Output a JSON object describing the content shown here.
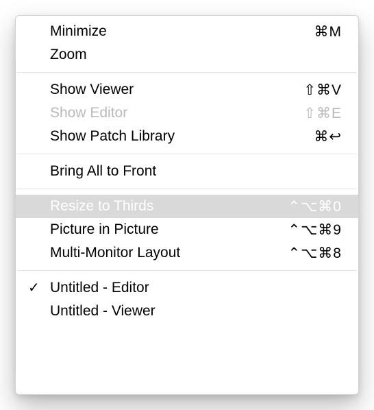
{
  "menu": {
    "minimize": {
      "label": "Minimize",
      "shortcut": "⌘M"
    },
    "zoom": {
      "label": "Zoom",
      "shortcut": ""
    },
    "showViewer": {
      "label": "Show Viewer",
      "shortcut": "⇧⌘V"
    },
    "showEditor": {
      "label": "Show Editor",
      "shortcut": "⇧⌘E"
    },
    "showPatch": {
      "label": "Show Patch Library",
      "shortcut": "⌘↩"
    },
    "bringFront": {
      "label": "Bring All to Front",
      "shortcut": ""
    },
    "resizeThirds": {
      "label": "Resize to Thirds",
      "shortcut": "⌃⌥⌘0"
    },
    "pip": {
      "label": "Picture in Picture",
      "shortcut": "⌃⌥⌘9"
    },
    "multimon": {
      "label": "Multi-Monitor Layout",
      "shortcut": "⌃⌥⌘8"
    },
    "winEditor": {
      "label": "Untitled - Editor",
      "shortcut": ""
    },
    "winViewer": {
      "label": "Untitled - Viewer",
      "shortcut": ""
    }
  }
}
